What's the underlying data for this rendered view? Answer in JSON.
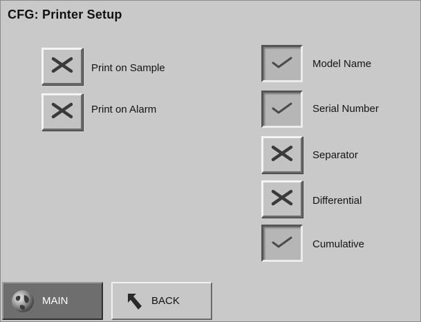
{
  "screen": {
    "title": "CFG: Printer Setup"
  },
  "left_options": [
    {
      "label": "Print on Sample",
      "state": "unchecked",
      "icon": "x-mark-icon"
    },
    {
      "label": "Print on Alarm",
      "state": "unchecked",
      "icon": "x-mark-icon"
    }
  ],
  "right_options": [
    {
      "label": "Model Name",
      "state": "checked",
      "icon": "checkmark-icon"
    },
    {
      "label": "Serial Number",
      "state": "checked",
      "icon": "checkmark-icon"
    },
    {
      "label": "Separator",
      "state": "unchecked",
      "icon": "x-mark-icon"
    },
    {
      "label": "Differential",
      "state": "unchecked",
      "icon": "x-mark-icon"
    },
    {
      "label": "Cumulative",
      "state": "checked",
      "icon": "checkmark-icon"
    }
  ],
  "nav": {
    "main_label": "MAIN",
    "back_label": "BACK",
    "main_icon": "globe-icon",
    "back_icon": "back-arrow-icon",
    "main_active": true
  },
  "colors": {
    "background": "#c9c9c9",
    "main_button": "#6e6e6e"
  }
}
